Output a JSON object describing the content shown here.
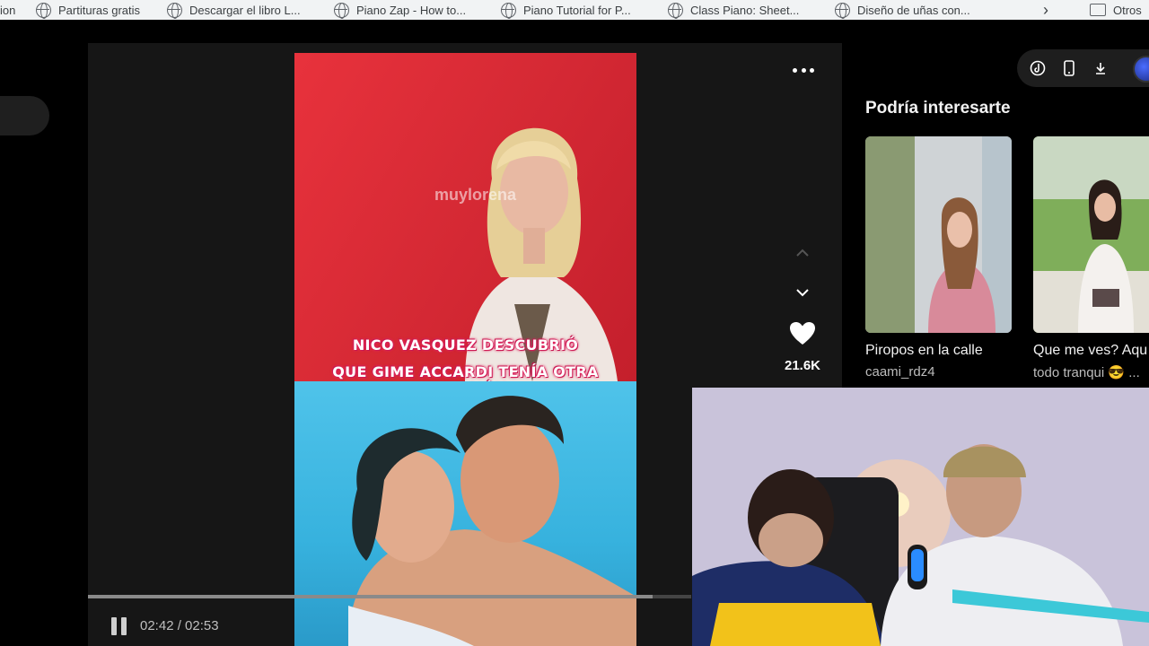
{
  "bookmarks": {
    "items": [
      {
        "label": "ion"
      },
      {
        "label": "Partituras gratis"
      },
      {
        "label": "Descargar el libro L..."
      },
      {
        "label": "Piano Zap - How to..."
      },
      {
        "label": "Piano Tutorial for P..."
      },
      {
        "label": "Class Piano: Sheet..."
      },
      {
        "label": "Diseño de uñas con..."
      }
    ],
    "folder_label": "Otros"
  },
  "video": {
    "watermark": "muylorena",
    "caption_line1": "NICO VASQUEZ DESCUBRIÓ",
    "caption_line2": "QUE GIME ACCARDI TENÍA  OTRA RELACIÓN",
    "likes": "21.6K",
    "time_display": "02:42 / 02:53",
    "progress": 0.936
  },
  "suggestions": {
    "title": "Podría interesarte",
    "items": [
      {
        "title": "Piropos en la calle",
        "user": "caami_rdz4"
      },
      {
        "title": "Que me ves? Aqu",
        "user": "todo tranqui 😎 ..."
      }
    ]
  },
  "icons": {
    "more": "more-icon",
    "up": "chevron-up-icon",
    "down": "chevron-down-icon",
    "like": "heart-icon",
    "pause": "pause-icon"
  },
  "colors": {
    "background": "#000000",
    "player_bg": "#161616",
    "bookmarks_bg": "#f1f3f4",
    "caption_glow": "#e0245e"
  }
}
